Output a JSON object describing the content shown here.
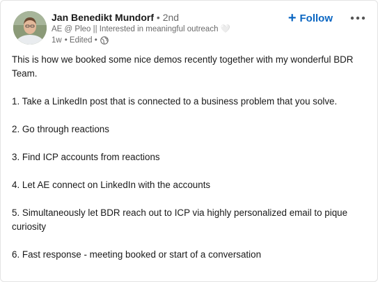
{
  "author": {
    "name": "Jan Benedikt Mundorf",
    "degree": "• 2nd",
    "headline": "AE @ Pleo || Interested in meaningful outreach 🤍",
    "time": "1w",
    "edited": "• Edited •",
    "visibility_icon": "globe-icon"
  },
  "follow": {
    "plus": "+",
    "label": "Follow"
  },
  "more_icon": "more-options-icon",
  "post": {
    "intro": "This is how we booked some nice demos recently together with my wonderful BDR Team.",
    "steps": [
      "1. Take a LinkedIn post that is connected to a business problem that you solve.",
      "2. Go through reactions",
      "3. Find ICP accounts from reactions",
      "4. Let AE connect on LinkedIn with the accounts",
      "5. Simultaneously let BDR reach out to ICP via highly personalized email to pique curiosity",
      "6. Fast response - meeting booked or start of a conversation"
    ]
  },
  "colors": {
    "accent": "#0a66c2",
    "text": "#191919",
    "muted": "#666666"
  }
}
